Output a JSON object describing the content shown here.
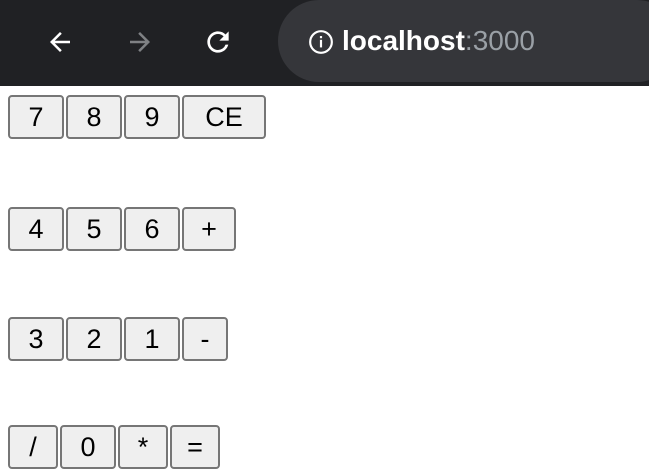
{
  "browser": {
    "url_host": "localhost",
    "url_port": ":3000",
    "icons": {
      "back": "back-arrow-icon",
      "forward": "forward-arrow-icon",
      "reload": "reload-icon",
      "info": "info-icon"
    },
    "colors": {
      "toolbar": "#202124",
      "omnibox": "#35363a",
      "host_text": "#ffffff",
      "port_text": "#9aa0a6",
      "forward_disabled": "#7f8184"
    }
  },
  "calculator": {
    "rows": [
      [
        "7",
        "8",
        "9",
        "CE"
      ],
      [
        "4",
        "5",
        "6",
        "+"
      ],
      [
        "3",
        "2",
        "1",
        "-"
      ],
      [
        "/",
        "0",
        "*",
        "="
      ]
    ]
  }
}
